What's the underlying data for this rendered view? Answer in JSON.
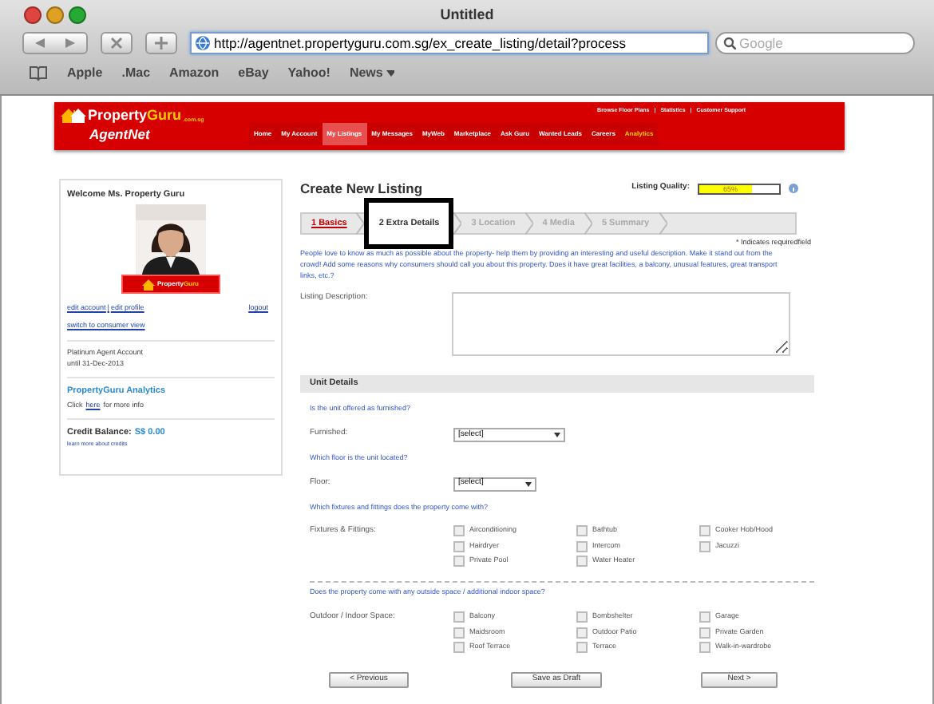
{
  "window": {
    "title": "Untitled"
  },
  "browser": {
    "url": "http://agentnet.propertyguru.com.sg/ex_create_listing/detail?process",
    "search_placeholder": "Google",
    "bookmarks": [
      {
        "label": "Apple",
        "menu": false
      },
      {
        "label": ".Mac",
        "menu": false
      },
      {
        "label": "Amazon",
        "menu": false
      },
      {
        "label": "eBay",
        "menu": false
      },
      {
        "label": "Yahoo!",
        "menu": false
      },
      {
        "label": "News",
        "menu": true
      }
    ]
  },
  "header": {
    "logo": {
      "first": "Property",
      "second": "Guru",
      "domain": ".com.sg"
    },
    "product": "AgentNet",
    "top_links": [
      "Browse Floor Plans",
      "Statistics",
      "Customer Support"
    ],
    "link_separator": "|",
    "nav": [
      {
        "label": "Home",
        "selected": false,
        "highlighted": false
      },
      {
        "label": "My Account",
        "selected": false,
        "highlighted": false
      },
      {
        "label": "My Listings",
        "selected": true,
        "highlighted": false
      },
      {
        "label": "My Messages",
        "selected": false,
        "highlighted": false
      },
      {
        "label": "MyWeb",
        "selected": false,
        "highlighted": false
      },
      {
        "label": "Marketplace",
        "selected": false,
        "highlighted": false
      },
      {
        "label": "Ask Guru",
        "selected": false,
        "highlighted": false
      },
      {
        "label": "Wanted Leads",
        "selected": false,
        "highlighted": false
      },
      {
        "label": "Careers",
        "selected": false,
        "highlighted": false
      },
      {
        "label": "Analytics",
        "selected": false,
        "highlighted": true
      }
    ]
  },
  "sidebar": {
    "welcome": "Welcome Ms. Property Guru",
    "photo": {
      "kind": "picture"
    },
    "badge": {
      "first": "Property",
      "second": "Guru"
    },
    "links": [
      "edit account",
      "edit profile",
      "logout"
    ],
    "link_separator": "|",
    "consumer_link": "switch to consumer view",
    "account": [
      "Platinum Agent Account",
      "until 31-Dec-2013"
    ],
    "analytics": {
      "title": "PropertyGuru Analytics",
      "before": "Click",
      "link": "here",
      "after": "for more info"
    },
    "credit": {
      "label": "Credit Balance:",
      "amount": "S$ 0.00",
      "link": "learn more about credits"
    }
  },
  "main": {
    "title": "Create New Listing",
    "quality": {
      "label": "Listing Quality:",
      "level": 0.65,
      "reading": "65%"
    },
    "tabs": [
      {
        "label": "1 Basics",
        "selected": false,
        "done": true
      },
      {
        "label": "2 Extra Details",
        "selected": true,
        "done": false
      },
      {
        "label": "3 Location",
        "selected": false,
        "done": false
      },
      {
        "label": "4 Media",
        "selected": false,
        "done": false
      },
      {
        "label": "5 Summary",
        "selected": false,
        "done": false
      }
    ],
    "required_note": "* Indicates requiredfield",
    "intro": "People love to know as much as possible about the property- help them by providing an interesting and useful description. Make it stand out from the crowd! Add some reasons why consumers should call you about this property. Does it have great facilities, a balcony, unusual features, great transport links, etc.?",
    "description_label": "Listing Description:",
    "section_title": "Unit Details",
    "questions": [
      {
        "question": "Is the unit offered as furnished?",
        "label": "Furnished:",
        "kind": "select",
        "value": "[select]",
        "divider": false
      },
      {
        "question": "Which floor is the unit located?",
        "label": "Floor:",
        "kind": "select",
        "value": "[select]",
        "divider": false
      },
      {
        "question": "Which fixtures and fittings does the property come with?",
        "label": "Fixtures & Fittings:",
        "kind": "checks",
        "divider": false,
        "options": [
          {
            "label": "Airconditioning",
            "checked": false
          },
          {
            "label": "Bathtub",
            "checked": false
          },
          {
            "label": "Cooker Hob/Hood",
            "checked": false
          },
          {
            "label": "Hairdryer",
            "checked": false
          },
          {
            "label": "Intercom",
            "checked": false
          },
          {
            "label": "Jacuzzi",
            "checked": false
          },
          {
            "label": "Private Pool",
            "checked": false
          },
          {
            "label": "Water Heater",
            "checked": false
          }
        ]
      },
      {
        "question": "Does the property come with any outside space / additional indoor space?",
        "label": "Outdoor / Indoor Space:",
        "kind": "checks",
        "divider": true,
        "options": [
          {
            "label": "Balcony",
            "checked": false
          },
          {
            "label": "Bombshelter",
            "checked": false
          },
          {
            "label": "Garage",
            "checked": false
          },
          {
            "label": "Maidsroom",
            "checked": false
          },
          {
            "label": "Outdoor Patio",
            "checked": false
          },
          {
            "label": "Private Garden",
            "checked": false
          },
          {
            "label": "Roof Terrace",
            "checked": false
          },
          {
            "label": "Terrace",
            "checked": false
          },
          {
            "label": "Walk-in-wardrobe",
            "checked": false
          }
        ]
      }
    ],
    "buttons": [
      "< Previous",
      "Save as Draft",
      "Next >"
    ]
  }
}
